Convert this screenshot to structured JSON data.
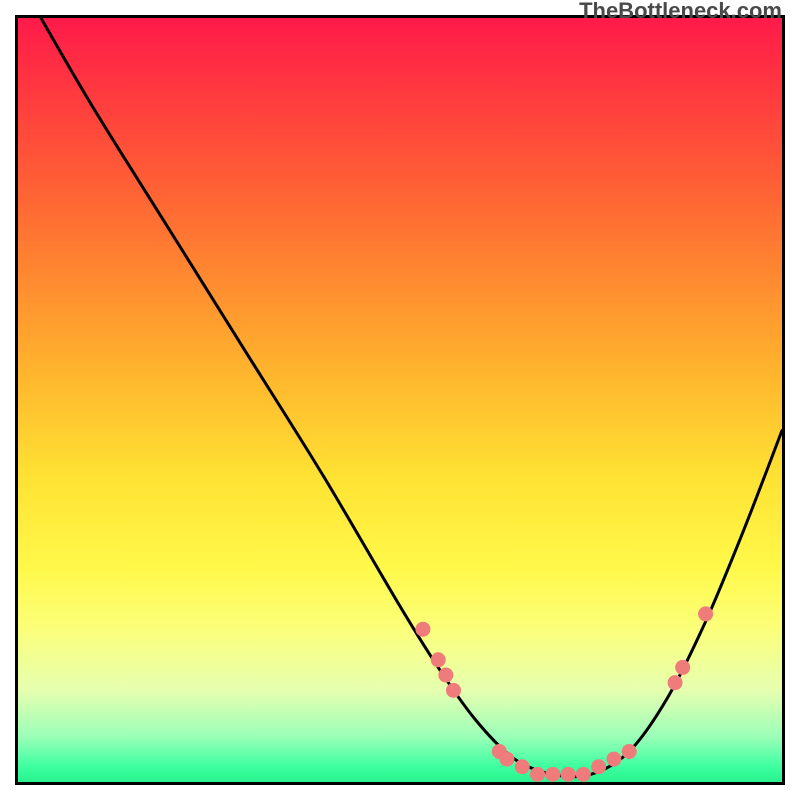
{
  "attribution": "TheBottleneck.com",
  "chart_data": {
    "type": "line",
    "title": "",
    "xlabel": "",
    "ylabel": "",
    "xlim": [
      0,
      100
    ],
    "ylim": [
      0,
      100
    ],
    "grid": false,
    "legend": false,
    "series": [
      {
        "name": "bottleneck-curve",
        "x": [
          3,
          10,
          20,
          30,
          40,
          50,
          55,
          60,
          65,
          70,
          75,
          80,
          85,
          90,
          95,
          100
        ],
        "y": [
          100,
          88,
          72,
          56,
          40,
          23,
          15,
          8,
          3,
          1,
          1,
          4,
          11,
          21,
          33,
          46
        ],
        "color": "#000000"
      }
    ],
    "markers": [
      {
        "x": 53,
        "y": 20
      },
      {
        "x": 55,
        "y": 16
      },
      {
        "x": 56,
        "y": 14
      },
      {
        "x": 57,
        "y": 12
      },
      {
        "x": 63,
        "y": 4
      },
      {
        "x": 64,
        "y": 3
      },
      {
        "x": 66,
        "y": 2
      },
      {
        "x": 68,
        "y": 1
      },
      {
        "x": 70,
        "y": 1
      },
      {
        "x": 72,
        "y": 1
      },
      {
        "x": 74,
        "y": 1
      },
      {
        "x": 76,
        "y": 2
      },
      {
        "x": 78,
        "y": 3
      },
      {
        "x": 80,
        "y": 4
      },
      {
        "x": 86,
        "y": 13
      },
      {
        "x": 87,
        "y": 15
      },
      {
        "x": 90,
        "y": 22
      }
    ],
    "marker_color": "#ef7b7b",
    "background": {
      "type": "vertical-gradient",
      "stops": [
        {
          "pos": 0.0,
          "color": "#ff1a4a"
        },
        {
          "pos": 0.25,
          "color": "#ff6a33"
        },
        {
          "pos": 0.5,
          "color": "#ffd233"
        },
        {
          "pos": 0.75,
          "color": "#fff94a"
        },
        {
          "pos": 0.92,
          "color": "#d0ffb0"
        },
        {
          "pos": 1.0,
          "color": "#29f28d"
        }
      ]
    }
  }
}
